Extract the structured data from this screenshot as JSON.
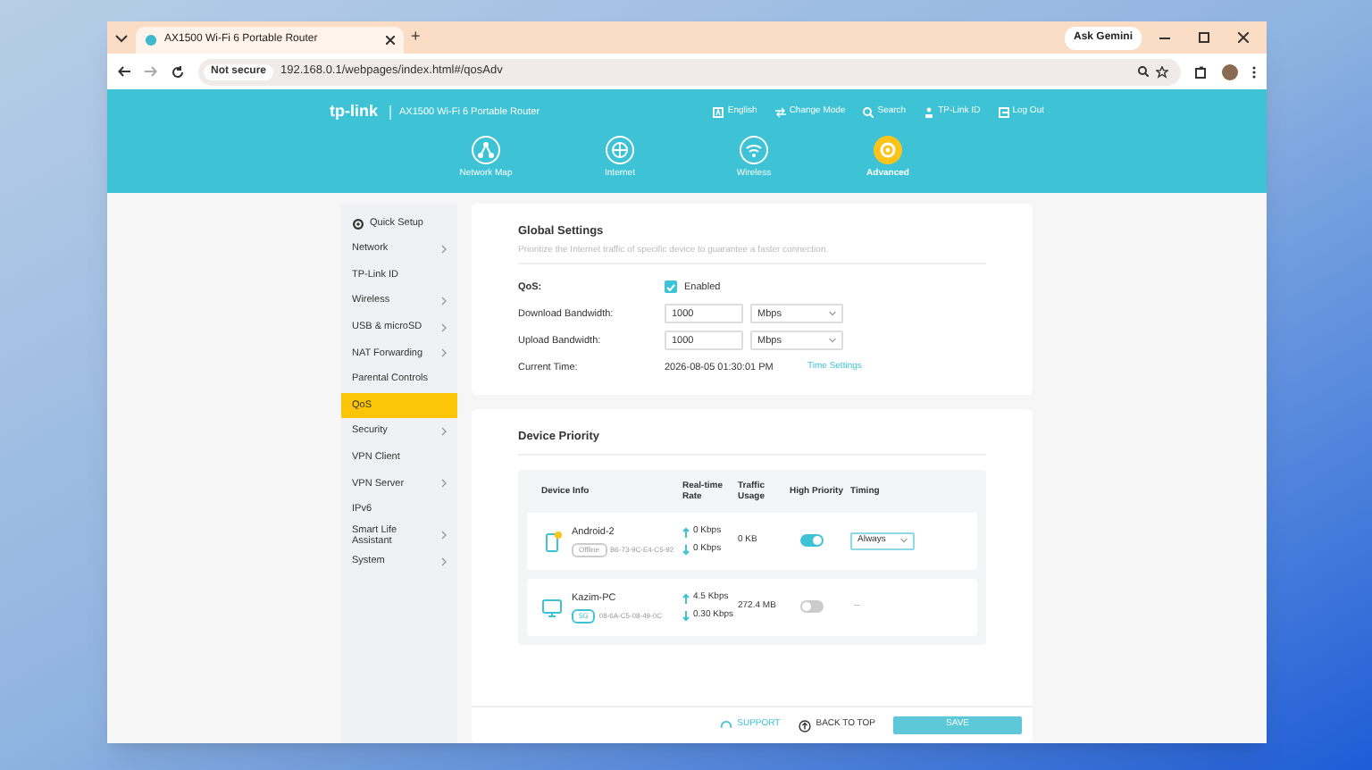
{
  "browser": {
    "tab_title": "AX1500 Wi-Fi 6 Portable Router",
    "new_tab": "+",
    "ask_gemini": "Ask Gemini",
    "security": "Not secure",
    "url": "192.168.0.1/webpages/index.html#/qosAdv"
  },
  "header": {
    "brand": "tp-link",
    "model": "AX1500 Wi-Fi 6 Portable Router",
    "links": [
      {
        "kind": "language",
        "label": "English"
      },
      {
        "kind": "mode",
        "label": "Change Mode"
      },
      {
        "kind": "search",
        "label": "Search"
      },
      {
        "kind": "account",
        "label": "TP-Link ID"
      },
      {
        "kind": "logout",
        "label": "Log Out"
      }
    ],
    "nav": [
      {
        "kind": "map",
        "label": "Network Map",
        "selected": false
      },
      {
        "kind": "globe",
        "label": "Internet",
        "selected": false
      },
      {
        "kind": "wifi",
        "label": "Wireless",
        "selected": false
      },
      {
        "kind": "gear",
        "label": "Advanced",
        "selected": true
      }
    ]
  },
  "sidebar": {
    "quick_setup": "Quick Setup",
    "items": [
      {
        "label": "Network",
        "has_submenu": true,
        "selected": false
      },
      {
        "label": "TP-Link ID",
        "has_submenu": false,
        "selected": false
      },
      {
        "label": "Wireless",
        "has_submenu": true,
        "selected": false
      },
      {
        "label": "USB & microSD",
        "has_submenu": true,
        "selected": false
      },
      {
        "label": "NAT Forwarding",
        "has_submenu": true,
        "selected": false
      },
      {
        "label": "Parental Controls",
        "has_submenu": false,
        "selected": false
      },
      {
        "label": "QoS",
        "has_submenu": false,
        "selected": true
      },
      {
        "label": "Security",
        "has_submenu": true,
        "selected": false
      },
      {
        "label": "VPN Client",
        "has_submenu": false,
        "selected": false
      },
      {
        "label": "VPN Server",
        "has_submenu": true,
        "selected": false
      },
      {
        "label": "IPv6",
        "has_submenu": false,
        "selected": false
      },
      {
        "label": "Smart Life Assistant",
        "has_submenu": true,
        "selected": false
      },
      {
        "label": "System",
        "has_submenu": true,
        "selected": false
      }
    ]
  },
  "global_settings": {
    "title": "Global Settings",
    "description": "Prioritize the Internet traffic of specific device to guarantee a faster connection.",
    "qos": {
      "label": "QoS:",
      "checked": true,
      "option": "Enabled"
    },
    "download": {
      "label": "Download Bandwidth:",
      "value": "1000",
      "unit": "Mbps"
    },
    "upload": {
      "label": "Upload Bandwidth:",
      "value": "1000",
      "unit": "Mbps"
    },
    "time": {
      "label": "Current Time:",
      "value": "2026-08-05 01:30:01 PM",
      "link": "Time Settings"
    }
  },
  "device_priority": {
    "title": "Device Priority",
    "columns": [
      "Device Info",
      "Real-time Rate",
      "Traffic Usage",
      "High Priority",
      "Timing"
    ],
    "rows": [
      {
        "kind": "phone",
        "name": "Android-2",
        "online": false,
        "badge": "Offline",
        "mac": "B6-73-9C-E4-C5-92",
        "up": "0 Kbps",
        "down": "0 Kbps",
        "usage": "0 KB",
        "high_priority": true,
        "timing": {
          "kind": "select",
          "value": "Always"
        }
      },
      {
        "kind": "pc",
        "name": "Kazim-PC",
        "online": true,
        "badge": "5G",
        "mac": "08-6A-C5-08-49-0C",
        "up": "4.5 Kbps",
        "down": "0.30 Kbps",
        "usage": "272.4 MB",
        "high_priority": false,
        "timing": {
          "kind": "text",
          "value": "--"
        }
      }
    ]
  },
  "footer": {
    "support": "SUPPORT",
    "back_to_top": "BACK TO TOP",
    "save": "SAVE"
  }
}
